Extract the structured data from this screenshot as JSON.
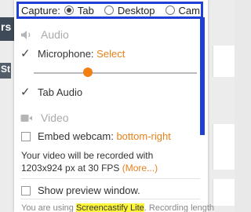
{
  "background": {
    "fragment_top": "rs",
    "fragment_mid": "St"
  },
  "capture": {
    "label": "Capture:",
    "options": [
      {
        "label": "Tab",
        "selected": true
      },
      {
        "label": "Desktop",
        "selected": false
      },
      {
        "label": "Cam",
        "selected": false
      }
    ],
    "highlight_color": "#1f3fd6"
  },
  "audio": {
    "section_title": "Audio",
    "microphone_label": "Microphone:",
    "microphone_value": "Select",
    "microphone_checked": true,
    "volume_level": 0.33,
    "tab_audio_label": "Tab Audio",
    "tab_audio_checked": true
  },
  "video": {
    "section_title": "Video",
    "embed_webcam_label": "Embed webcam:",
    "embed_webcam_value": "bottom-right",
    "embed_webcam_checked": false,
    "info_line1": "Your video will be recorded with",
    "info_line2_prefix": "1203x924 px at 30 FPS",
    "more_link": "(More...)"
  },
  "preview": {
    "label": "Show preview window.",
    "checked": false
  },
  "footer": {
    "prefix": "You are using",
    "product": "Screencastify Lite",
    "suffix": ". Recording length"
  },
  "colors": {
    "accent_orange": "#e8801a",
    "slider_thumb": "#f07f14",
    "highlight_yellow": "#fff73a"
  }
}
